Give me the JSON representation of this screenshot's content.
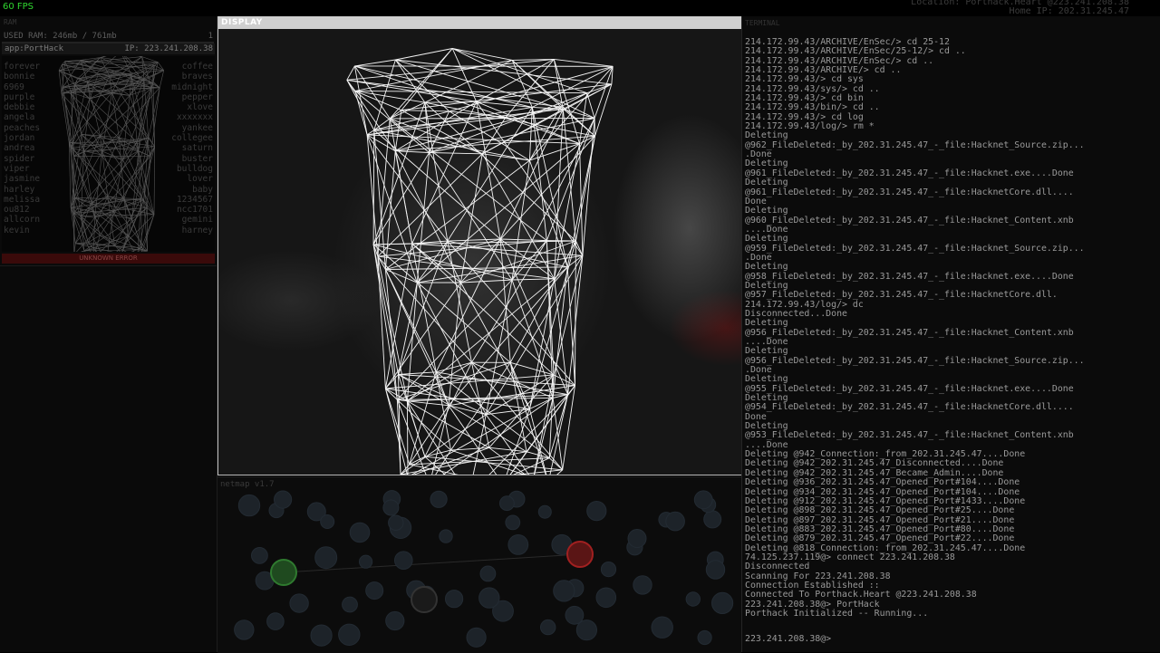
{
  "topbar": {
    "fps": "60 FPS",
    "location": "Location: Porthack.Heart @223.241.208.38",
    "home_ip": "Home IP: 202.31.245.47"
  },
  "ram": {
    "title": "RAM",
    "used": "USED RAM: 246mb / 761mb",
    "count": "1",
    "app_name": "app:PortHack",
    "app_ip": "IP: 223.241.208.38",
    "passwords_left": [
      "forever",
      "bonnie",
      "6969",
      "purple",
      "debbie",
      "angela",
      "peaches",
      "jordan",
      "andrea",
      "spider",
      "viper",
      "jasmine",
      "harley",
      "melissa",
      "ou812",
      "allcorn",
      "kevin"
    ],
    "passwords_right": [
      "coffee",
      "braves",
      "midnight",
      "pepper",
      "xlove",
      "xxxxxxx",
      "yankee",
      "collegee",
      "saturn",
      "buster",
      "bulldog",
      "lover",
      "baby",
      "1234567",
      "ncc1701",
      "gemini",
      "harney"
    ],
    "error": "UNKNOWN ERROR"
  },
  "display": {
    "title": "DISPLAY"
  },
  "netmap": {
    "title": "netmap v1.7"
  },
  "terminal": {
    "title": "TERMINAL",
    "lines": [
      "214.172.99.43/ARCHIVE/EnSec/> cd 25-12",
      "214.172.99.43/ARCHIVE/EnSec/25-12/> cd ..",
      "214.172.99.43/ARCHIVE/EnSec/> cd ..",
      "214.172.99.43/ARCHIVE/> cd ..",
      "214.172.99.43/> cd sys",
      "214.172.99.43/sys/> cd ..",
      "214.172.99.43/> cd bin",
      "214.172.99.43/bin/> cd ..",
      "214.172.99.43/> cd log",
      "214.172.99.43/log/> rm *",
      "Deleting",
      "@962_FileDeleted:_by_202.31.245.47_-_file:Hacknet_Source.zip...",
      ".Done",
      "Deleting",
      "@961_FileDeleted:_by_202.31.245.47_-_file:Hacknet.exe....Done",
      "Deleting",
      "@961_FileDeleted:_by_202.31.245.47_-_file:HacknetCore.dll....",
      "Done",
      "Deleting",
      "@960_FileDeleted:_by_202.31.245.47_-_file:Hacknet_Content.xnb",
      "....Done",
      "Deleting",
      "@959_FileDeleted:_by_202.31.245.47_-_file:Hacknet_Source.zip...",
      ".Done",
      "Deleting",
      "@958_FileDeleted:_by_202.31.245.47_-_file:Hacknet.exe....Done",
      "Deleting",
      "@957_FileDeleted:_by_202.31.245.47_-_file:HacknetCore.dll.",
      "214.172.99.43/log/> dc",
      "Disconnected...Done",
      "Deleting",
      "@956_FileDeleted:_by_202.31.245.47_-_file:Hacknet_Content.xnb",
      "....Done",
      "Deleting",
      "@956_FileDeleted:_by_202.31.245.47_-_file:Hacknet_Source.zip...",
      ".Done",
      "Deleting",
      "@955_FileDeleted:_by_202.31.245.47_-_file:Hacknet.exe....Done",
      "Deleting",
      "@954_FileDeleted:_by_202.31.245.47_-_file:HacknetCore.dll....",
      "Done",
      "Deleting",
      "@953_FileDeleted:_by_202.31.245.47_-_file:Hacknet_Content.xnb",
      "....Done",
      "Deleting @942_Connection:_from_202.31.245.47....Done",
      "Deleting @942_202.31.245.47_Disconnected....Done",
      "Deleting @942_202.31.245.47_Became_Admin....Done",
      "Deleting @936_202.31.245.47_Opened_Port#104....Done",
      "Deleting @934_202.31.245.47_Opened_Port#104....Done",
      "Deleting @912_202.31.245.47_Opened_Port#1433....Done",
      "Deleting @898_202.31.245.47_Opened_Port#25....Done",
      "Deleting @897_202.31.245.47_Opened_Port#21....Done",
      "Deleting @883_202.31.245.47_Opened_Port#80....Done",
      "Deleting @879_202.31.245.47_Opened_Port#22....Done",
      "Deleting @818_Connection:_from_202.31.245.47....Done",
      "74.125.237.119@> connect 223.241.208.38",
      "Disconnected",
      "Scanning For 223.241.208.38",
      "Connection Established ::",
      "Connected To Porthack.Heart @223.241.208.38",
      "223.241.208.38@> PortHack",
      "Porthack Initialized -- Running..."
    ],
    "prompt": "223.241.208.38@>"
  }
}
